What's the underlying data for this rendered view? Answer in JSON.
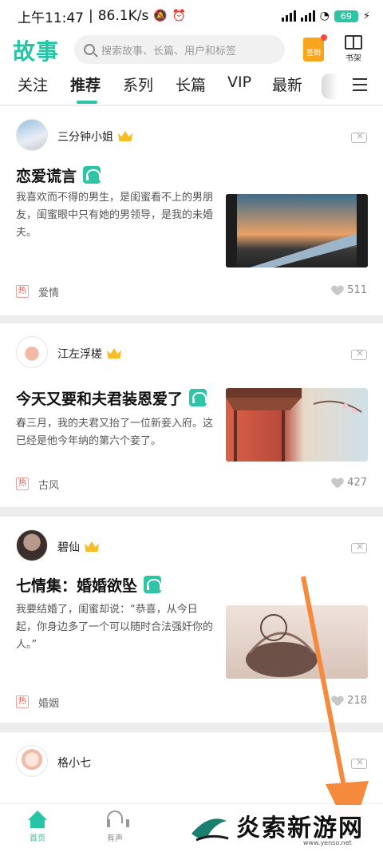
{
  "status": {
    "time": "上午11:47",
    "speed": "86.1K/s",
    "battery": "69"
  },
  "header": {
    "logo": "故事",
    "search_placeholder": "搜索故事、长篇、用户和标签",
    "signin_label": "签到",
    "shelf_label": "书架"
  },
  "tabs": [
    "关注",
    "推荐",
    "系列",
    "长篇",
    "VIP",
    "最新"
  ],
  "cards": [
    {
      "author": "三分钟小姐",
      "title": "恋爱谎言",
      "summary": "我喜欢而不得的男生，是闺蜜看不上的男朋友，闺蜜眼中只有她的男领导，是我的未婚夫。",
      "tag": "爱情",
      "likes": "511"
    },
    {
      "author": "江左浮槎",
      "title": "今天又要和夫君装恩爱了",
      "summary": "春三月，我的夫君又抬了一位新妾入府。这已经是他今年纳的第六个妾了。",
      "tag": "古风",
      "likes": "427"
    },
    {
      "author": "碧仙",
      "title": "七情集：婚婚欲坠",
      "summary": "我要结婚了，闺蜜却说：“恭喜，从今日起，你身边多了一个可以随时合法强奸你的人。”",
      "tag": "婚姻",
      "likes": "218"
    },
    {
      "author": "格小七",
      "title": "",
      "summary": "",
      "tag": "",
      "likes": ""
    }
  ],
  "hot_badge": "热",
  "navbar": {
    "home": "首页",
    "audio": "有声"
  },
  "watermark": {
    "text": "炎索新游网",
    "url": "www.yenso.net"
  },
  "colors": {
    "accent": "#27c4a5",
    "arrow": "#f58a3c"
  }
}
